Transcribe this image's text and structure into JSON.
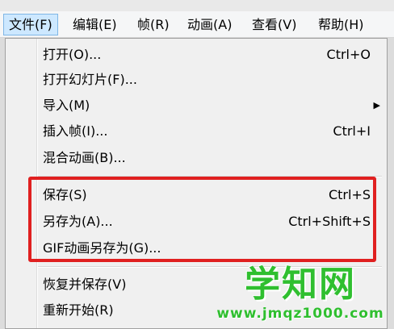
{
  "menubar": {
    "items": [
      {
        "label": "文件(F)"
      },
      {
        "label": "编辑(E)"
      },
      {
        "label": "帧(R)"
      },
      {
        "label": "动画(A)"
      },
      {
        "label": "查看(V)"
      },
      {
        "label": "帮助(H)"
      }
    ]
  },
  "file_menu": {
    "items": [
      {
        "label": "打开(O)...",
        "shortcut": "Ctrl+O"
      },
      {
        "label": "打开幻灯片(F)..."
      },
      {
        "label": "导入(M)",
        "submenu_arrow": "▶"
      },
      {
        "label": "插入帧(I)...",
        "shortcut": "Ctrl+I"
      },
      {
        "label": "混合动画(B)..."
      },
      {
        "label": "保存(S)",
        "shortcut": "Ctrl+S"
      },
      {
        "label": "另存为(A)...",
        "shortcut": "Ctrl+Shift+S"
      },
      {
        "label": "GIF动画另存为(G)..."
      },
      {
        "label": "恢复并保存(V)"
      },
      {
        "label": "重新开始(R)"
      }
    ]
  },
  "watermark": {
    "title": "学知网",
    "url": "www.jmqz1000.com",
    "color": "#2fbf2f"
  },
  "highlight_color": "#e02020"
}
